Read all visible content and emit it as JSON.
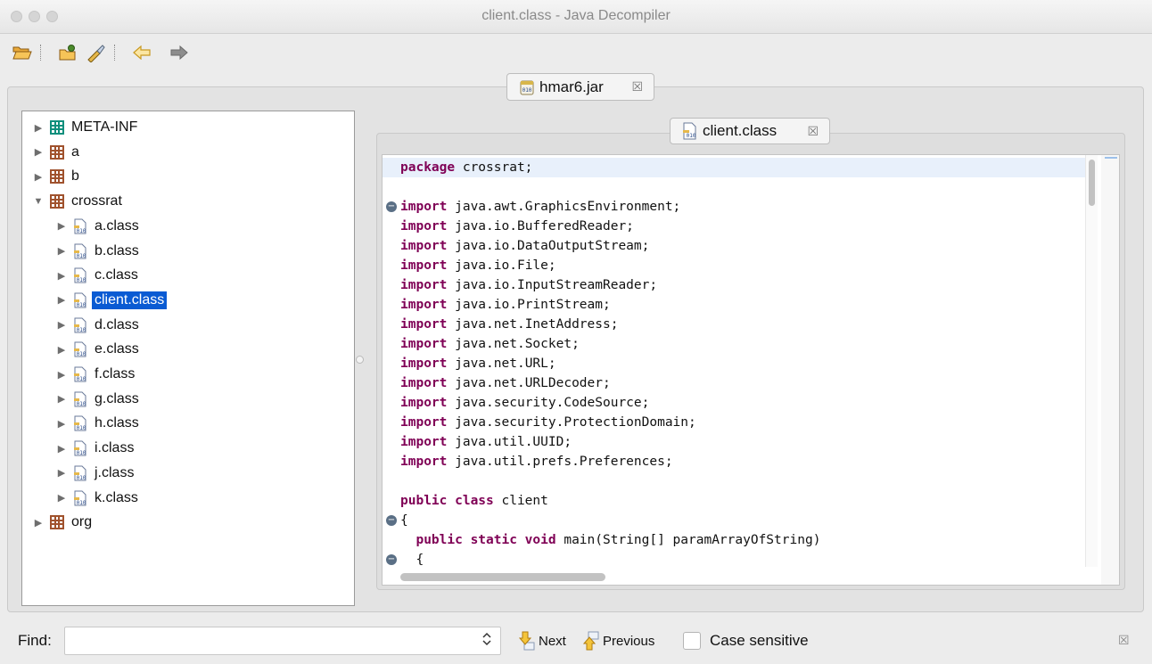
{
  "window": {
    "title": "client.class - Java Decompiler"
  },
  "toolbar": {
    "buttons": [
      {
        "name": "open-file-button",
        "icon": "open-folder-icon"
      },
      {
        "name": "open-type-button",
        "icon": "folder-person-icon"
      },
      {
        "name": "search-button",
        "icon": "flashlight-icon"
      },
      {
        "name": "back-button",
        "icon": "back-arrow-icon"
      },
      {
        "name": "forward-button",
        "icon": "forward-arrow-icon"
      }
    ]
  },
  "outer_tab": {
    "label": "hmar6.jar",
    "close": "☒"
  },
  "inner_tab": {
    "label": "client.class",
    "close": "☒"
  },
  "tree": {
    "items": [
      {
        "label": "META-INF",
        "type": "package-folder",
        "level": 0,
        "expanded": false
      },
      {
        "label": "a",
        "type": "package",
        "level": 0,
        "expanded": false
      },
      {
        "label": "b",
        "type": "package",
        "level": 0,
        "expanded": false
      },
      {
        "label": "crossrat",
        "type": "package",
        "level": 0,
        "expanded": true
      },
      {
        "label": "a.class",
        "type": "class",
        "level": 1,
        "expanded": false
      },
      {
        "label": "b.class",
        "type": "class",
        "level": 1,
        "expanded": false
      },
      {
        "label": "c.class",
        "type": "class",
        "level": 1,
        "expanded": false
      },
      {
        "label": "client.class",
        "type": "class",
        "level": 1,
        "expanded": false,
        "selected": true
      },
      {
        "label": "d.class",
        "type": "class",
        "level": 1,
        "expanded": false
      },
      {
        "label": "e.class",
        "type": "class",
        "level": 1,
        "expanded": false
      },
      {
        "label": "f.class",
        "type": "class",
        "level": 1,
        "expanded": false
      },
      {
        "label": "g.class",
        "type": "class",
        "level": 1,
        "expanded": false
      },
      {
        "label": "h.class",
        "type": "class",
        "level": 1,
        "expanded": false
      },
      {
        "label": "i.class",
        "type": "class",
        "level": 1,
        "expanded": false
      },
      {
        "label": "j.class",
        "type": "class",
        "level": 1,
        "expanded": false
      },
      {
        "label": "k.class",
        "type": "class",
        "level": 1,
        "expanded": false
      },
      {
        "label": "org",
        "type": "package",
        "level": 0,
        "expanded": false
      }
    ]
  },
  "code": {
    "lines": [
      {
        "kw": "package",
        "rest": " crossrat;",
        "highlight": true
      },
      {
        "kw": "",
        "rest": ""
      },
      {
        "kw": "import",
        "rest": " java.awt.GraphicsEnvironment;",
        "fold": true
      },
      {
        "kw": "import",
        "rest": " java.io.BufferedReader;"
      },
      {
        "kw": "import",
        "rest": " java.io.DataOutputStream;"
      },
      {
        "kw": "import",
        "rest": " java.io.File;"
      },
      {
        "kw": "import",
        "rest": " java.io.InputStreamReader;"
      },
      {
        "kw": "import",
        "rest": " java.io.PrintStream;"
      },
      {
        "kw": "import",
        "rest": " java.net.InetAddress;"
      },
      {
        "kw": "import",
        "rest": " java.net.Socket;"
      },
      {
        "kw": "import",
        "rest": " java.net.URL;"
      },
      {
        "kw": "import",
        "rest": " java.net.URLDecoder;"
      },
      {
        "kw": "import",
        "rest": " java.security.CodeSource;"
      },
      {
        "kw": "import",
        "rest": " java.security.ProtectionDomain;"
      },
      {
        "kw": "import",
        "rest": " java.util.UUID;"
      },
      {
        "kw": "import",
        "rest": " java.util.prefs.Preferences;"
      },
      {
        "kw": "",
        "rest": ""
      },
      {
        "kw": "public class",
        "rest": " client"
      },
      {
        "kw": "",
        "rest": "{",
        "fold": true
      },
      {
        "kw": "  public static void",
        "rest": " main(String[] paramArrayOfString)"
      },
      {
        "kw": "",
        "rest": "  {",
        "fold": true
      }
    ]
  },
  "find": {
    "label": "Find:",
    "value": "",
    "placeholder": "",
    "next_label": "Next",
    "previous_label": "Previous",
    "case_label": "Case sensitive",
    "close": "☒"
  },
  "colors": {
    "keyword": "#7f0055",
    "selection": "#0a5bd3",
    "package_icon": "#a0522d",
    "meta_icon": "#0f8f7d"
  }
}
